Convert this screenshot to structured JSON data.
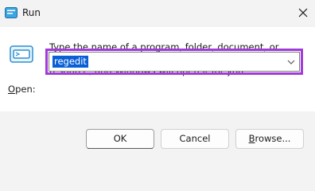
{
  "window": {
    "title": "Run",
    "icons": {
      "app": "run-app-icon",
      "close": "close-icon",
      "run": "run-icon",
      "dropdown": "chevron-down-icon"
    }
  },
  "content": {
    "description_line1": "Type the name of a program, folder, document, or Internet",
    "description_line2": "resource, and Windows will open it for you.",
    "open_label_prefix": "O",
    "open_label_rest": "pen:",
    "input": {
      "value": "regedit"
    },
    "highlight_color": "#a23ad9",
    "selection_color": "#0a5fd6"
  },
  "buttons": {
    "ok": "OK",
    "cancel": "Cancel",
    "browse_prefix": "B",
    "browse_rest": "rowse..."
  }
}
